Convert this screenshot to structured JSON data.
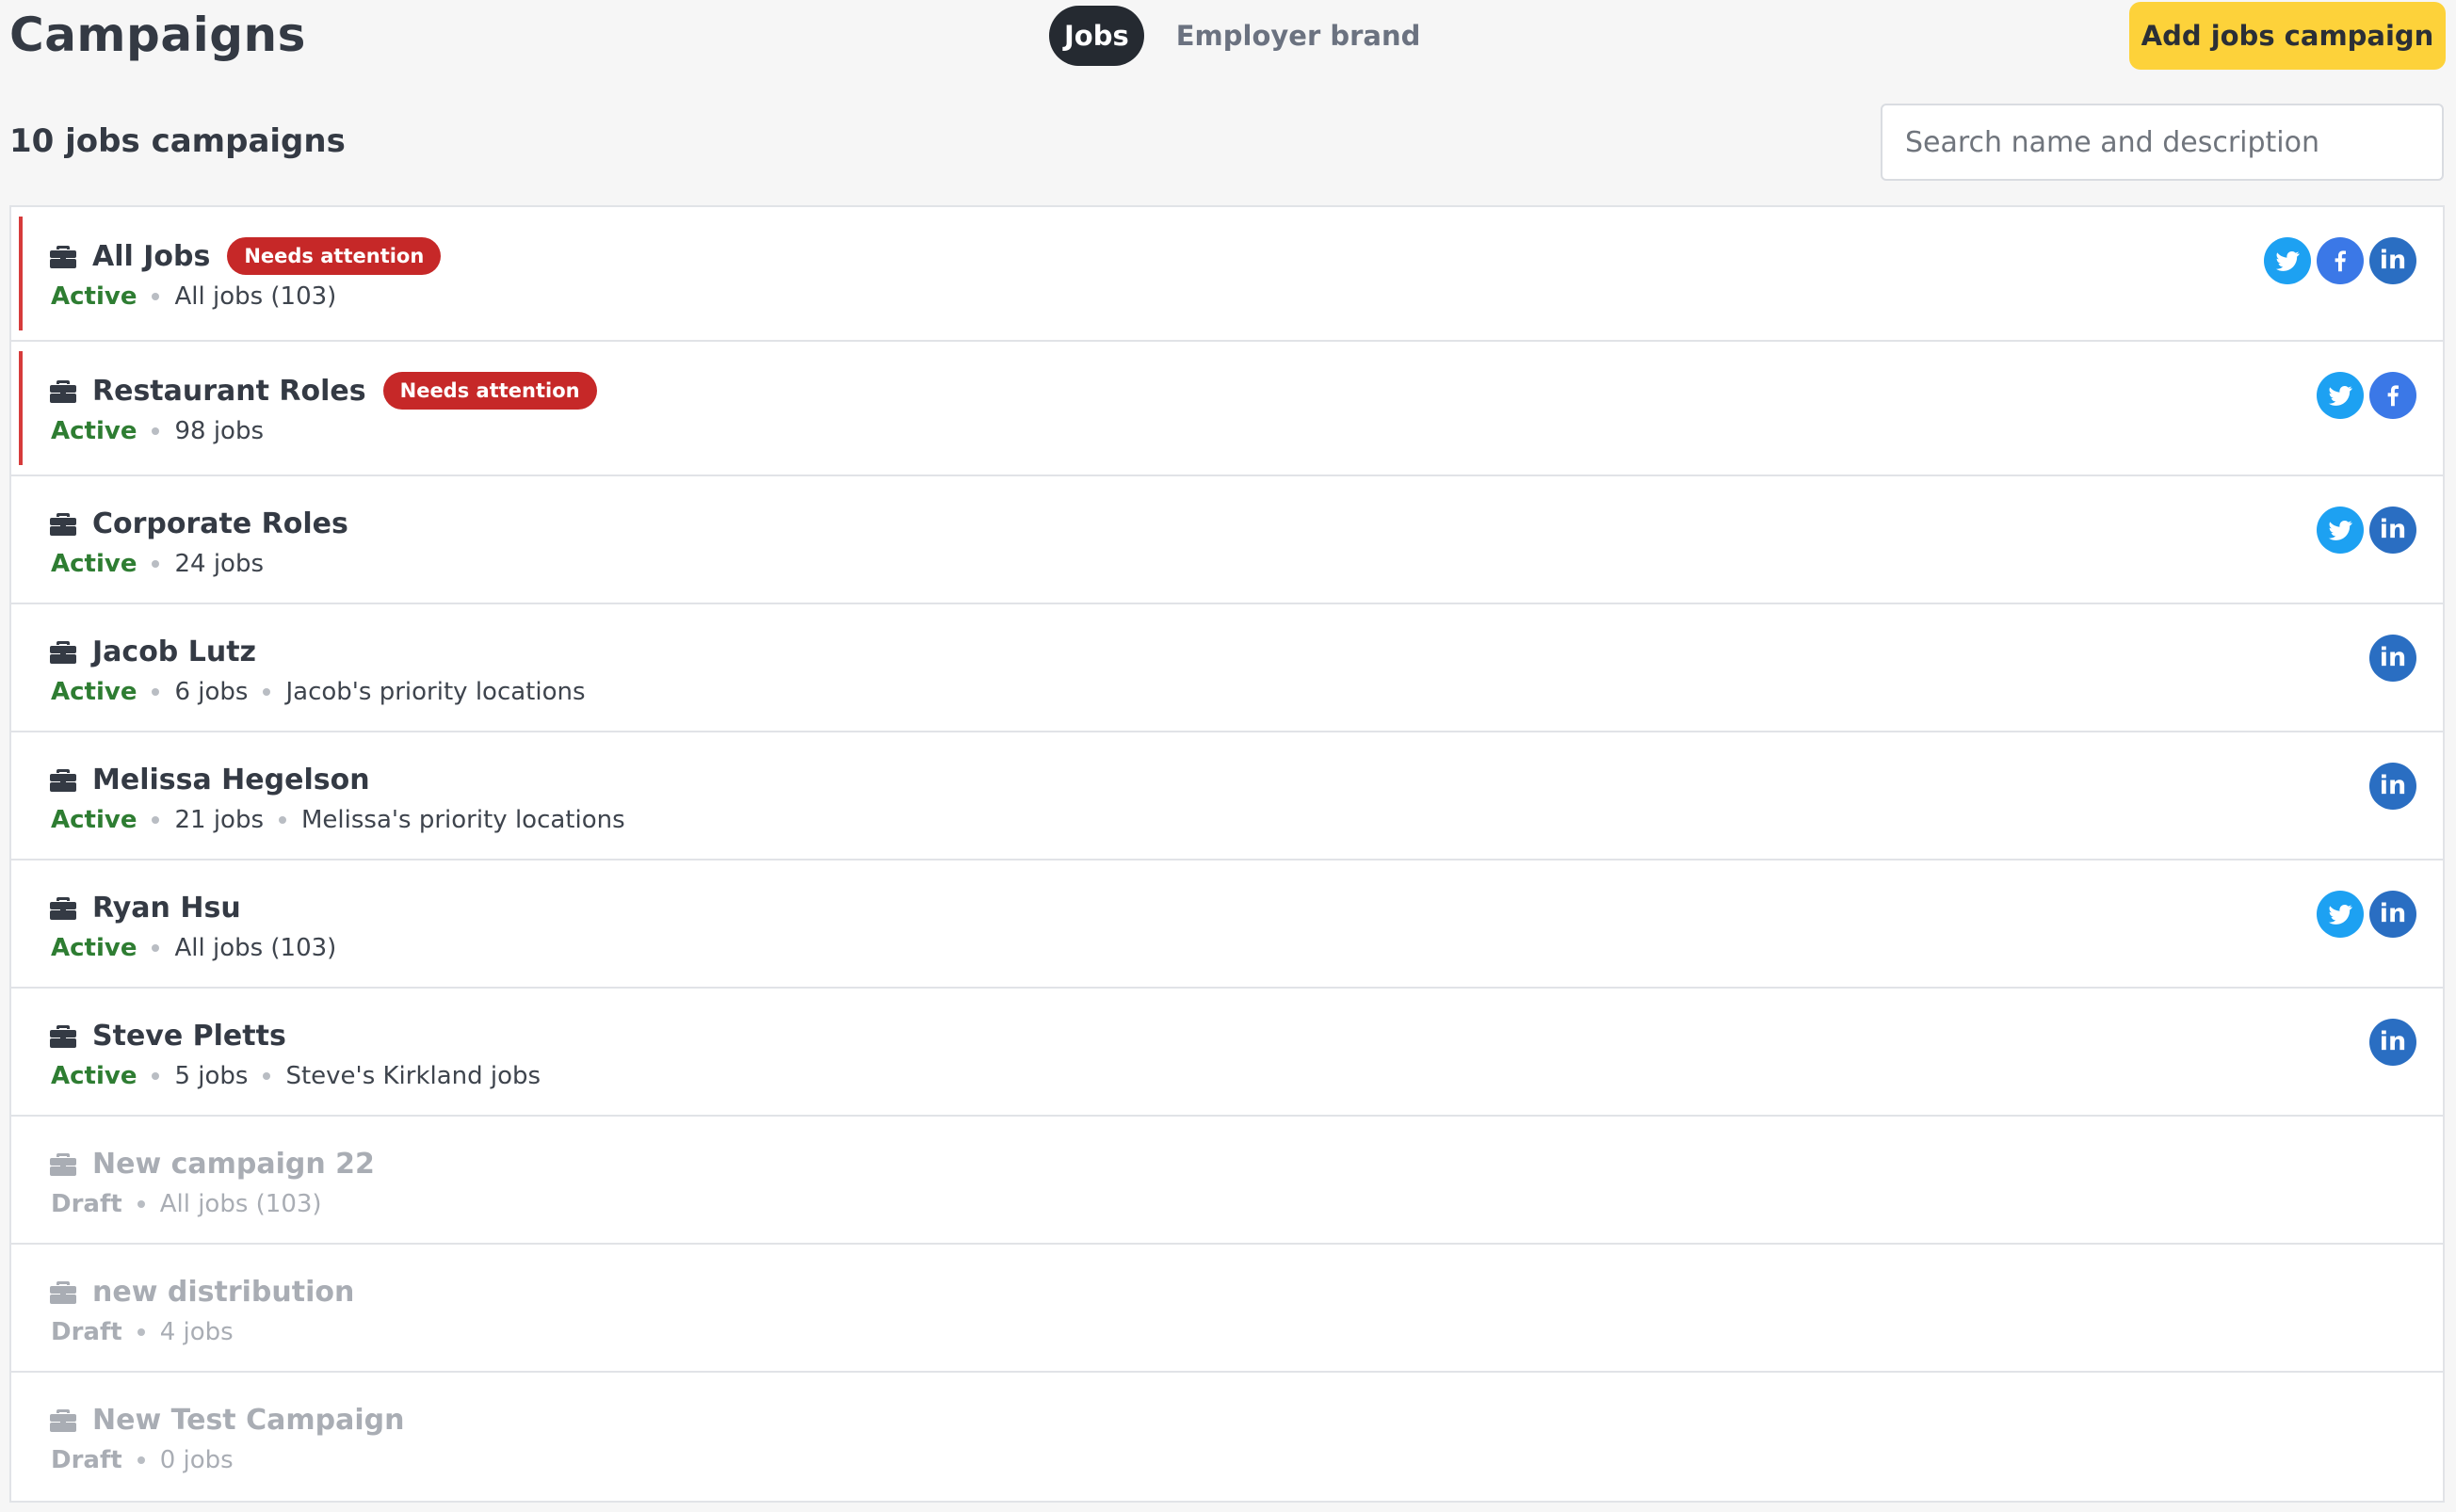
{
  "header": {
    "title": "Campaigns",
    "tabs": [
      {
        "label": "Jobs",
        "active": true
      },
      {
        "label": "Employer brand",
        "active": false
      }
    ],
    "add_button_label": "Add jobs campaign",
    "accent_color": "#fdd23a"
  },
  "summary": {
    "count_label": "10 jobs campaigns"
  },
  "search": {
    "placeholder": "Search name and description",
    "value": ""
  },
  "campaigns": [
    {
      "name": "All Jobs",
      "badge": "Needs attention",
      "status": "Active",
      "jobs": "All jobs (103)",
      "extra": "",
      "socials": [
        "twitter",
        "facebook",
        "linkedin"
      ]
    },
    {
      "name": "Restaurant Roles",
      "badge": "Needs attention",
      "status": "Active",
      "jobs": "98 jobs",
      "extra": "",
      "socials": [
        "twitter",
        "facebook"
      ]
    },
    {
      "name": "Corporate Roles",
      "badge": "",
      "status": "Active",
      "jobs": "24 jobs",
      "extra": "",
      "socials": [
        "twitter",
        "linkedin"
      ]
    },
    {
      "name": "Jacob Lutz",
      "badge": "",
      "status": "Active",
      "jobs": "6 jobs",
      "extra": "Jacob's priority locations",
      "socials": [
        "linkedin"
      ]
    },
    {
      "name": "Melissa Hegelson",
      "badge": "",
      "status": "Active",
      "jobs": "21 jobs",
      "extra": "Melissa's priority locations",
      "socials": [
        "linkedin"
      ]
    },
    {
      "name": "Ryan Hsu",
      "badge": "",
      "status": "Active",
      "jobs": "All jobs (103)",
      "extra": "",
      "socials": [
        "twitter",
        "linkedin"
      ]
    },
    {
      "name": "Steve Pletts",
      "badge": "",
      "status": "Active",
      "jobs": "5 jobs",
      "extra": "Steve's Kirkland jobs",
      "socials": [
        "linkedin"
      ]
    },
    {
      "name": "New campaign 22",
      "badge": "",
      "status": "Draft",
      "jobs": "All jobs (103)",
      "extra": "",
      "socials": []
    },
    {
      "name": "new distribution",
      "badge": "",
      "status": "Draft",
      "jobs": "4 jobs",
      "extra": "",
      "socials": []
    },
    {
      "name": "New Test Campaign",
      "badge": "",
      "status": "Draft",
      "jobs": "0 jobs",
      "extra": "",
      "socials": []
    }
  ],
  "icons": {
    "campaign": "briefcase-icon",
    "twitter": "twitter-icon",
    "facebook": "facebook-icon",
    "linkedin": "linkedin-icon"
  },
  "colors": {
    "active_status": "#2e7d32",
    "attention_badge": "#c62828",
    "twitter": "#1da1f2",
    "facebook": "#3b78e7",
    "linkedin": "#2a6ec2"
  }
}
